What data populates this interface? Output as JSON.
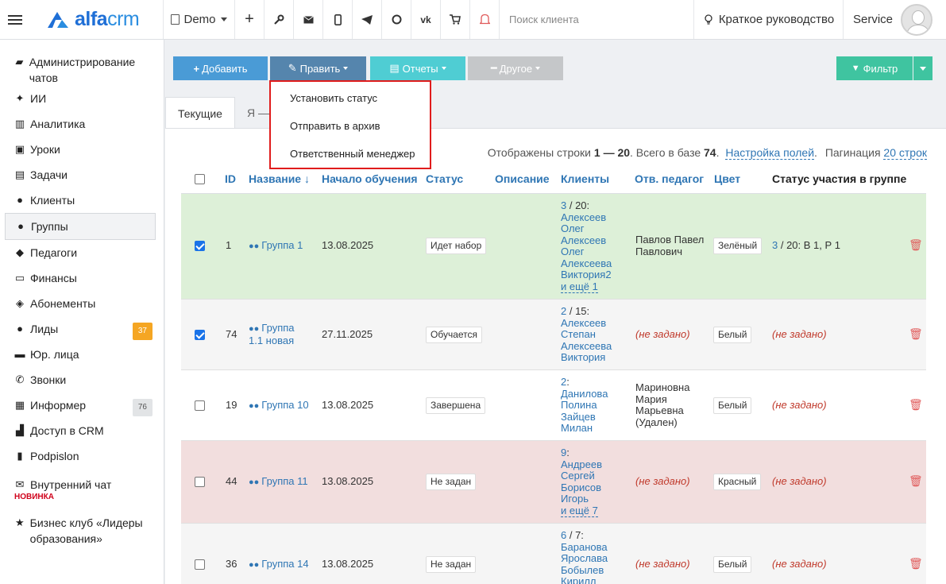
{
  "header": {
    "logo_text_a": "alfa",
    "logo_text_b": "crm",
    "demo_label": "Demo",
    "search_placeholder": "Поиск клиента",
    "guide_label": "Краткое руководство",
    "user_name": "Service",
    "icons": [
      "plus-icon",
      "wrench-icon",
      "mail-icon",
      "phone-icon",
      "telegram-icon",
      "whatsapp-icon",
      "vk-icon",
      "cart-icon",
      "bell-icon"
    ]
  },
  "sidebar": {
    "items": [
      {
        "label": "Администрирование чатов",
        "icon": "chat-icon"
      },
      {
        "label": "ИИ",
        "icon": "sparkle-icon"
      },
      {
        "label": "Аналитика",
        "icon": "analytics-icon"
      },
      {
        "label": "Уроки",
        "icon": "calendar-icon"
      },
      {
        "label": "Задачи",
        "icon": "tasks-icon"
      },
      {
        "label": "Клиенты",
        "icon": "user-icon"
      },
      {
        "label": "Группы",
        "icon": "users-icon"
      },
      {
        "label": "Педагоги",
        "icon": "graduation-icon"
      },
      {
        "label": "Финансы",
        "icon": "money-icon"
      },
      {
        "label": "Абонементы",
        "icon": "tag-icon"
      },
      {
        "label": "Лиды",
        "icon": "user-plus-icon",
        "badge": "37"
      },
      {
        "label": "Юр. лица",
        "icon": "briefcase-icon"
      },
      {
        "label": "Звонки",
        "icon": "phone-icon"
      },
      {
        "label": "Информер",
        "icon": "informer-icon",
        "badge": "76"
      },
      {
        "label": "Доступ в CRM",
        "icon": "lock-icon"
      },
      {
        "label": "Podpislon",
        "icon": "document-icon"
      },
      {
        "label": "Внутренний чат",
        "icon": "envelope-icon",
        "sub": "НОВИНКА"
      },
      {
        "label": "Бизнес клуб «Лидеры образования»",
        "icon": "star-icon"
      }
    ]
  },
  "toolbar": {
    "add_label": "Добавить",
    "edit_label": "Править",
    "reports_label": "Отчеты",
    "other_label": "Другое",
    "filter_label": "Фильтр"
  },
  "dropdown": {
    "items": [
      "Установить статус",
      "Отправить в архив",
      "Ответственный менеджер"
    ]
  },
  "tabs": [
    "Текущие",
    "Я —"
  ],
  "info": {
    "prefix": "Отображены строки",
    "range": "1 — 20",
    "total_prefix": ". Всего в базе",
    "total": "74",
    "dot": ".",
    "fields_link": "Настройка полей",
    "pagination_label": "Пагинация",
    "pagination_value": "20 строк"
  },
  "table": {
    "columns": {
      "id": "ID",
      "name": "Название ↓",
      "start": "Начало обучения",
      "status": "Статус",
      "description": "Описание",
      "clients": "Клиенты",
      "teacher": "Отв. педагог",
      "color": "Цвет",
      "participation": "Статус участия в группе"
    },
    "rows": [
      {
        "checked": true,
        "id": "1",
        "name": "Группа 1",
        "start": "13.08.2025",
        "status": "Идет набор",
        "clients_count": "3",
        "clients_limit": " / 20:",
        "clients": [
          "Алексеев",
          "Олег",
          "Алексеев",
          "Олег",
          "Алексеева",
          "Виктория2"
        ],
        "clients_more": "и ещё 1",
        "teacher": "Павлов Павел Павлович",
        "color": "Зелёный",
        "part_count": "3",
        "part_rest": " / 20:  В 1, Р 1"
      },
      {
        "checked": true,
        "id": "74",
        "name": "Группа 1.1 новая",
        "start": "27.11.2025",
        "status": "Обучается",
        "clients_count": "2",
        "clients_limit": " / 15:",
        "clients": [
          "Алексеев",
          "Степан",
          "Алексеева",
          "Виктория"
        ],
        "clients_more": "",
        "teacher": "(не задано)",
        "color": "Белый",
        "part_count": "",
        "part_rest": "(не задано)"
      },
      {
        "checked": false,
        "id": "19",
        "name": "Группа 10",
        "start": "13.08.2025",
        "status": "Завершена",
        "clients_count": "2",
        "clients_limit": ":",
        "clients": [
          "Данилова",
          "Полина",
          "Зайцев",
          "Милан"
        ],
        "clients_more": "",
        "teacher": "Мариновна Мария Марьевна (Удален)",
        "color": "Белый",
        "part_count": "",
        "part_rest": "(не задано)"
      },
      {
        "checked": false,
        "id": "44",
        "name": "Группа 11",
        "start": "13.08.2025",
        "status": "Не задан",
        "clients_count": "9",
        "clients_limit": ":",
        "clients": [
          "Андреев",
          "Сергей",
          "Борисов",
          "Игорь"
        ],
        "clients_more": "и ещё 7",
        "teacher": "(не задано)",
        "color": "Красный",
        "part_count": "",
        "part_rest": "(не задано)"
      },
      {
        "checked": false,
        "id": "36",
        "name": "Группа 14",
        "start": "13.08.2025",
        "status": "Не задан",
        "clients_count": "6",
        "clients_limit": " / 7:",
        "clients": [
          "Баранова",
          "Ярослава",
          "Бобылев",
          "Кирилл"
        ],
        "clients_more": "",
        "teacher": "(не задано)",
        "color": "Белый",
        "part_count": "",
        "part_rest": "(не задано)"
      }
    ]
  }
}
